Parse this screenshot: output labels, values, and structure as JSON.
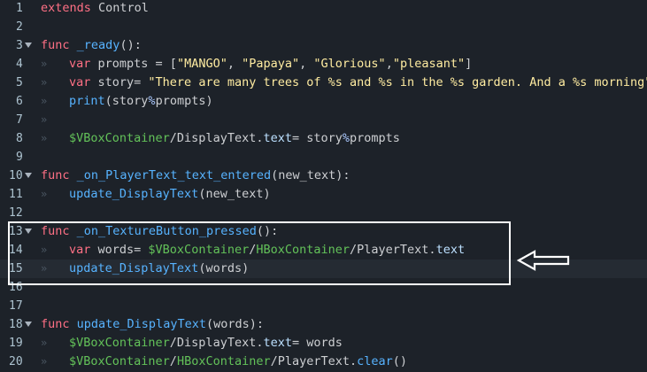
{
  "editor": {
    "lines": [
      {
        "n": "1",
        "tokens": [
          {
            "c": "kw",
            "t": "extends"
          },
          {
            "c": "plain",
            "t": " Control"
          }
        ]
      },
      {
        "n": "2",
        "tokens": []
      },
      {
        "n": "3",
        "fold": true,
        "tokens": [
          {
            "c": "kw",
            "t": "func"
          },
          {
            "c": "plain",
            "t": " "
          },
          {
            "c": "fn",
            "t": "_ready"
          },
          {
            "c": "plain",
            "t": "():"
          }
        ]
      },
      {
        "n": "4",
        "indent": true,
        "tokens": [
          {
            "c": "kw",
            "t": "var"
          },
          {
            "c": "plain",
            "t": " prompts = ["
          },
          {
            "c": "str",
            "t": "\"MANGO\""
          },
          {
            "c": "plain",
            "t": ", "
          },
          {
            "c": "str",
            "t": "\"Papaya\""
          },
          {
            "c": "plain",
            "t": ", "
          },
          {
            "c": "str",
            "t": "\"Glorious\""
          },
          {
            "c": "plain",
            "t": ","
          },
          {
            "c": "str",
            "t": "\"pleasant\""
          },
          {
            "c": "plain",
            "t": "]"
          }
        ]
      },
      {
        "n": "5",
        "indent": true,
        "tokens": [
          {
            "c": "kw",
            "t": "var"
          },
          {
            "c": "plain",
            "t": " story= "
          },
          {
            "c": "str",
            "t": "\"There are many trees of %s and %s in the %s garden. And a %s morning\""
          }
        ]
      },
      {
        "n": "6",
        "indent": true,
        "tokens": [
          {
            "c": "fn",
            "t": "print"
          },
          {
            "c": "plain",
            "t": "(story"
          },
          {
            "c": "op",
            "t": "%"
          },
          {
            "c": "plain",
            "t": "prompts)"
          }
        ]
      },
      {
        "n": "7",
        "indent": true,
        "tokens": []
      },
      {
        "n": "8",
        "indent": true,
        "tokens": [
          {
            "c": "node",
            "t": "$VBoxContainer"
          },
          {
            "c": "plain",
            "t": "/DisplayText."
          },
          {
            "c": "prop",
            "t": "text"
          },
          {
            "c": "plain",
            "t": "= story"
          },
          {
            "c": "op",
            "t": "%"
          },
          {
            "c": "plain",
            "t": "prompts"
          }
        ]
      },
      {
        "n": "9",
        "tokens": []
      },
      {
        "n": "10",
        "fold": true,
        "tokens": [
          {
            "c": "kw",
            "t": "func"
          },
          {
            "c": "plain",
            "t": " "
          },
          {
            "c": "fn",
            "t": "_on_PlayerText_text_entered"
          },
          {
            "c": "plain",
            "t": "(new_text):"
          }
        ]
      },
      {
        "n": "11",
        "indent": true,
        "tokens": [
          {
            "c": "fn",
            "t": "update_DisplayText"
          },
          {
            "c": "plain",
            "t": "(new_text)"
          }
        ]
      },
      {
        "n": "12",
        "tokens": []
      },
      {
        "n": "13",
        "fold": true,
        "tokens": [
          {
            "c": "kw",
            "t": "func"
          },
          {
            "c": "plain",
            "t": " "
          },
          {
            "c": "fn",
            "t": "_on_TextureButton_pressed"
          },
          {
            "c": "plain",
            "t": "():"
          }
        ]
      },
      {
        "n": "14",
        "indent": true,
        "tokens": [
          {
            "c": "kw",
            "t": "var"
          },
          {
            "c": "plain",
            "t": " words= "
          },
          {
            "c": "node",
            "t": "$VBoxContainer"
          },
          {
            "c": "plain",
            "t": "/"
          },
          {
            "c": "node",
            "t": "HBoxContainer"
          },
          {
            "c": "plain",
            "t": "/PlayerText."
          },
          {
            "c": "prop",
            "t": "text"
          }
        ]
      },
      {
        "n": "15",
        "indent": true,
        "current": true,
        "tokens": [
          {
            "c": "fn",
            "t": "update_DisplayText"
          },
          {
            "c": "plain",
            "t": "(words)"
          }
        ]
      },
      {
        "n": "16",
        "tokens": []
      },
      {
        "n": "17",
        "tokens": []
      },
      {
        "n": "18",
        "fold": true,
        "tokens": [
          {
            "c": "kw",
            "t": "func"
          },
          {
            "c": "plain",
            "t": " "
          },
          {
            "c": "fn",
            "t": "update_DisplayText"
          },
          {
            "c": "plain",
            "t": "(words):"
          }
        ]
      },
      {
        "n": "19",
        "indent": true,
        "tokens": [
          {
            "c": "node",
            "t": "$VBoxContainer"
          },
          {
            "c": "plain",
            "t": "/DisplayText."
          },
          {
            "c": "prop",
            "t": "text"
          },
          {
            "c": "plain",
            "t": "= words"
          }
        ]
      },
      {
        "n": "20",
        "indent": true,
        "tokens": [
          {
            "c": "node",
            "t": "$VBoxContainer"
          },
          {
            "c": "plain",
            "t": "/"
          },
          {
            "c": "node",
            "t": "HBoxContainer"
          },
          {
            "c": "plain",
            "t": "/PlayerText."
          },
          {
            "c": "fn",
            "t": "clear"
          },
          {
            "c": "plain",
            "t": "()"
          }
        ]
      }
    ],
    "tab_glyph": "»"
  },
  "colors": {
    "background": "#1d2229",
    "keyword": "#ff7085",
    "function": "#57b3ff",
    "string": "#ffeca1",
    "node_path": "#63c259",
    "highlight_box": "#ffffff"
  }
}
